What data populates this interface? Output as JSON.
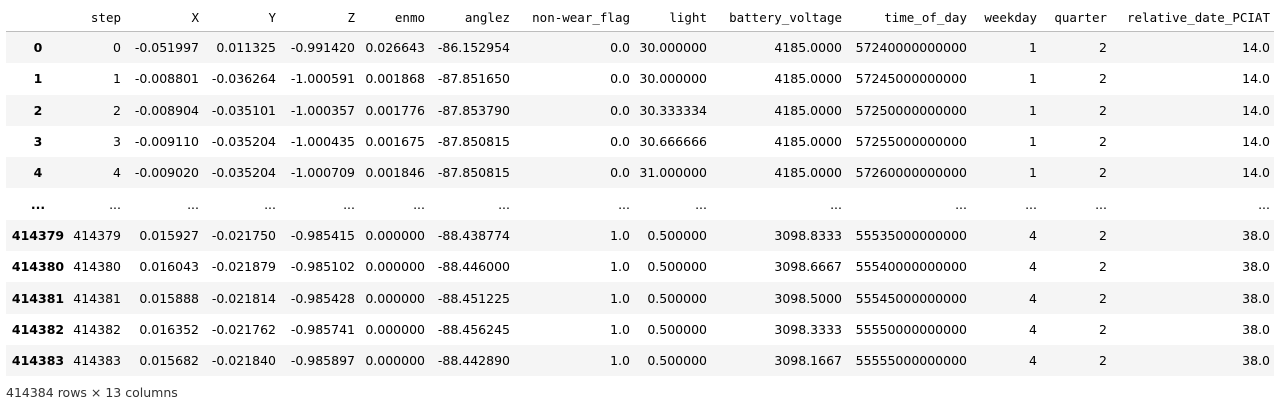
{
  "dataframe": {
    "columns": [
      "step",
      "X",
      "Y",
      "Z",
      "enmo",
      "anglez",
      "non-wear_flag",
      "light",
      "battery_voltage",
      "time_of_day",
      "weekday",
      "quarter",
      "relative_date_PCIAT"
    ],
    "rows": [
      {
        "index": "0",
        "cells": [
          "0",
          "-0.051997",
          "0.011325",
          "-0.991420",
          "0.026643",
          "-86.152954",
          "0.0",
          "30.000000",
          "4185.0000",
          "57240000000000",
          "1",
          "2",
          "14.0"
        ]
      },
      {
        "index": "1",
        "cells": [
          "1",
          "-0.008801",
          "-0.036264",
          "-1.000591",
          "0.001868",
          "-87.851650",
          "0.0",
          "30.000000",
          "4185.0000",
          "57245000000000",
          "1",
          "2",
          "14.0"
        ]
      },
      {
        "index": "2",
        "cells": [
          "2",
          "-0.008904",
          "-0.035101",
          "-1.000357",
          "0.001776",
          "-87.853790",
          "0.0",
          "30.333334",
          "4185.0000",
          "57250000000000",
          "1",
          "2",
          "14.0"
        ]
      },
      {
        "index": "3",
        "cells": [
          "3",
          "-0.009110",
          "-0.035204",
          "-1.000435",
          "0.001675",
          "-87.850815",
          "0.0",
          "30.666666",
          "4185.0000",
          "57255000000000",
          "1",
          "2",
          "14.0"
        ]
      },
      {
        "index": "4",
        "cells": [
          "4",
          "-0.009020",
          "-0.035204",
          "-1.000709",
          "0.001846",
          "-87.850815",
          "0.0",
          "31.000000",
          "4185.0000",
          "57260000000000",
          "1",
          "2",
          "14.0"
        ]
      },
      {
        "index": "...",
        "cells": [
          "...",
          "...",
          "...",
          "...",
          "...",
          "...",
          "...",
          "...",
          "...",
          "...",
          "...",
          "...",
          "..."
        ]
      },
      {
        "index": "414379",
        "cells": [
          "414379",
          "0.015927",
          "-0.021750",
          "-0.985415",
          "0.000000",
          "-88.438774",
          "1.0",
          "0.500000",
          "3098.8333",
          "55535000000000",
          "4",
          "2",
          "38.0"
        ]
      },
      {
        "index": "414380",
        "cells": [
          "414380",
          "0.016043",
          "-0.021879",
          "-0.985102",
          "0.000000",
          "-88.446000",
          "1.0",
          "0.500000",
          "3098.6667",
          "55540000000000",
          "4",
          "2",
          "38.0"
        ]
      },
      {
        "index": "414381",
        "cells": [
          "414381",
          "0.015888",
          "-0.021814",
          "-0.985428",
          "0.000000",
          "-88.451225",
          "1.0",
          "0.500000",
          "3098.5000",
          "55545000000000",
          "4",
          "2",
          "38.0"
        ]
      },
      {
        "index": "414382",
        "cells": [
          "414382",
          "0.016352",
          "-0.021762",
          "-0.985741",
          "0.000000",
          "-88.456245",
          "1.0",
          "0.500000",
          "3098.3333",
          "55550000000000",
          "4",
          "2",
          "38.0"
        ]
      },
      {
        "index": "414383",
        "cells": [
          "414383",
          "0.015682",
          "-0.021840",
          "-0.985897",
          "0.000000",
          "-88.442890",
          "1.0",
          "0.500000",
          "3098.1667",
          "55555000000000",
          "4",
          "2",
          "38.0"
        ]
      }
    ],
    "shape_caption": "414384 rows × 13 columns"
  }
}
